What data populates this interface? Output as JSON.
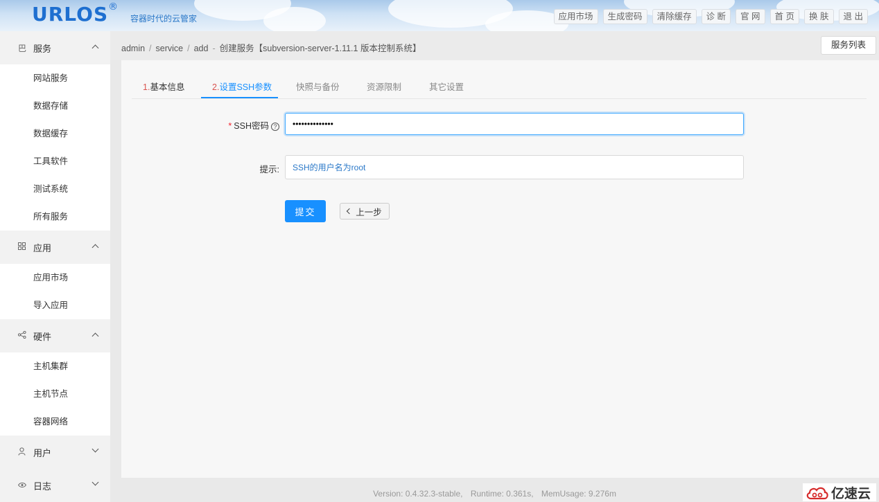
{
  "header": {
    "logo": "URLOS",
    "registered": "®",
    "tagline": "容器时代的云管家",
    "nav": [
      "应用市场",
      "生成密码",
      "清除缓存",
      "诊 断",
      "官 网",
      "首 页",
      "换 肤",
      "退 出"
    ]
  },
  "sidebar": {
    "groups": [
      {
        "label": "服务",
        "icon": "service-icon",
        "items": [
          "网站服务",
          "数据存储",
          "数据缓存",
          "工具软件",
          "测试系统",
          "所有服务"
        ]
      },
      {
        "label": "应用",
        "icon": "apps-grid-icon",
        "items": [
          "应用市场",
          "导入应用"
        ]
      },
      {
        "label": "硬件",
        "icon": "share-nodes-icon",
        "items": [
          "主机集群",
          "主机节点",
          "容器网络"
        ]
      },
      {
        "label": "用户",
        "icon": "user-icon",
        "items": []
      },
      {
        "label": "日志",
        "icon": "eye-icon",
        "items": []
      }
    ]
  },
  "breadcrumb": {
    "parts": [
      "admin",
      "service",
      "add"
    ],
    "title": "创建服务【subversion-server-1.11.1 版本控制系统】"
  },
  "list_button": "服务列表",
  "tabs": [
    {
      "num": "1.",
      "label": "基本信息",
      "state": "done"
    },
    {
      "num": "2.",
      "label": "设置SSH参数",
      "state": "active"
    },
    {
      "num": "",
      "label": "快照与备份",
      "state": "pending"
    },
    {
      "num": "",
      "label": "资源限制",
      "state": "pending"
    },
    {
      "num": "",
      "label": "其它设置",
      "state": "pending"
    }
  ],
  "form": {
    "required_mark": "*",
    "ssh_password_label": "SSH密码",
    "help_icon": "question-circle-icon",
    "ssh_password_value": "••••••••••••••",
    "hint_label": "提示:",
    "hint_value": "SSH的用户名为root",
    "submit_label": "提交",
    "prev_label": "上一步"
  },
  "footer": {
    "version": "Version: 0.4.32.3-stable,",
    "runtime": "Runtime: 0.361s,",
    "mem": "MemUsage: 9.276m"
  },
  "watermark": "亿速云",
  "colors": {
    "primary": "#1890ff",
    "required": "#f5222d",
    "logo": "#1e6fd0"
  }
}
